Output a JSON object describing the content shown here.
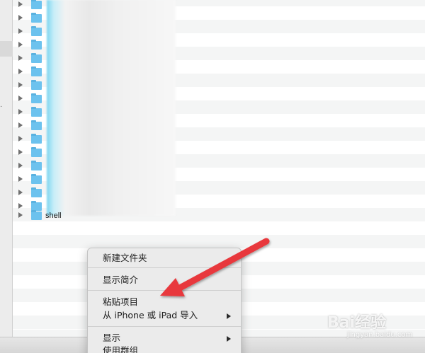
{
  "file_list": {
    "visible_item_name": "shell",
    "accent_folder_color": "#6cc2ee"
  },
  "context_menu": {
    "items": [
      {
        "label": "新建文件夹",
        "submenu": false
      },
      {
        "label": "显示简介",
        "submenu": false
      },
      {
        "label": "粘贴项目",
        "submenu": false
      },
      {
        "label": "从 iPhone 或 iPad 导入",
        "submenu": true
      },
      {
        "label": "显示",
        "submenu": true
      },
      {
        "label": "使用群组",
        "submenu": false
      }
    ]
  },
  "annotation": {
    "arrow_color": "#e8393c"
  },
  "watermark": {
    "brand": "Bai经验",
    "domain": "jingyan.baidu.com"
  }
}
